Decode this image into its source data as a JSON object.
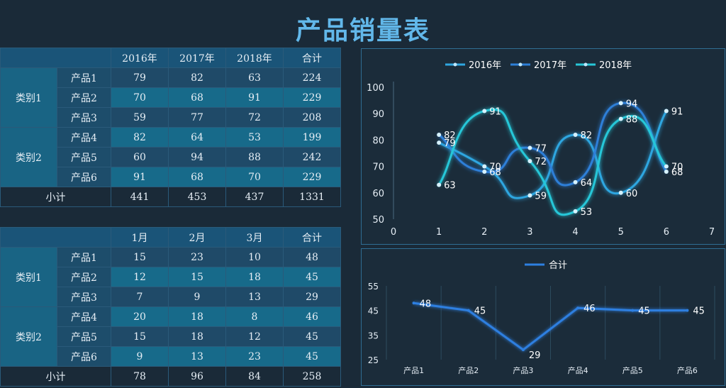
{
  "title": "产品销量表",
  "table1": {
    "headers": [
      "2016年",
      "2017年",
      "2018年",
      "合计"
    ],
    "groups": [
      {
        "name": "类别1",
        "rows": [
          {
            "product": "产品1",
            "values": [
              79,
              82,
              63,
              224
            ]
          },
          {
            "product": "产品2",
            "values": [
              70,
              68,
              91,
              229
            ]
          },
          {
            "product": "产品3",
            "values": [
              59,
              77,
              72,
              208
            ]
          }
        ]
      },
      {
        "name": "类别2",
        "rows": [
          {
            "product": "产品4",
            "values": [
              82,
              64,
              53,
              199
            ]
          },
          {
            "product": "产品5",
            "values": [
              60,
              94,
              88,
              242
            ]
          },
          {
            "product": "产品6",
            "values": [
              91,
              68,
              70,
              229
            ]
          }
        ]
      }
    ],
    "subtotal_label": "小计",
    "subtotal": [
      441,
      453,
      437,
      1331
    ]
  },
  "table2": {
    "headers": [
      "1月",
      "2月",
      "3月",
      "合计"
    ],
    "groups": [
      {
        "name": "类别1",
        "rows": [
          {
            "product": "产品1",
            "values": [
              15,
              23,
              10,
              48
            ]
          },
          {
            "product": "产品2",
            "values": [
              12,
              15,
              18,
              45
            ]
          },
          {
            "product": "产品3",
            "values": [
              7,
              9,
              13,
              29
            ]
          }
        ]
      },
      {
        "name": "类别2",
        "rows": [
          {
            "product": "产品4",
            "values": [
              20,
              18,
              8,
              46
            ]
          },
          {
            "product": "产品5",
            "values": [
              15,
              18,
              12,
              45
            ]
          },
          {
            "product": "产品6",
            "values": [
              9,
              13,
              23,
              45
            ]
          }
        ]
      }
    ],
    "subtotal_label": "小计",
    "subtotal": [
      78,
      96,
      84,
      258
    ]
  },
  "chart_data": [
    {
      "type": "scatter",
      "title": "",
      "xlabel": "",
      "ylabel": "",
      "xlim": [
        0,
        7
      ],
      "ylim": [
        50,
        100
      ],
      "xticks": [
        0,
        1,
        2,
        3,
        4,
        5,
        6,
        7
      ],
      "yticks": [
        50,
        60,
        70,
        80,
        90,
        100
      ],
      "legend": "top",
      "x": [
        1,
        2,
        3,
        4,
        5,
        6
      ],
      "series": [
        {
          "name": "2016年",
          "values": [
            79,
            70,
            59,
            82,
            60,
            91
          ],
          "color": "#2fa6e0"
        },
        {
          "name": "2017年",
          "values": [
            82,
            68,
            77,
            64,
            94,
            68
          ],
          "color": "#2d7fd8"
        },
        {
          "name": "2018年",
          "values": [
            63,
            91,
            72,
            53,
            88,
            70
          ],
          "color": "#27c7d8"
        }
      ]
    },
    {
      "type": "line",
      "title": "",
      "xlabel": "",
      "ylabel": "",
      "ylim": [
        25,
        55
      ],
      "yticks": [
        25,
        35,
        45,
        55
      ],
      "legend": "top",
      "categories": [
        "产品1",
        "产品2",
        "产品3",
        "产品4",
        "产品5",
        "产品6"
      ],
      "series": [
        {
          "name": "合计",
          "values": [
            48,
            45,
            29,
            46,
            45,
            45
          ],
          "color": "#2d7fe0"
        }
      ]
    }
  ]
}
